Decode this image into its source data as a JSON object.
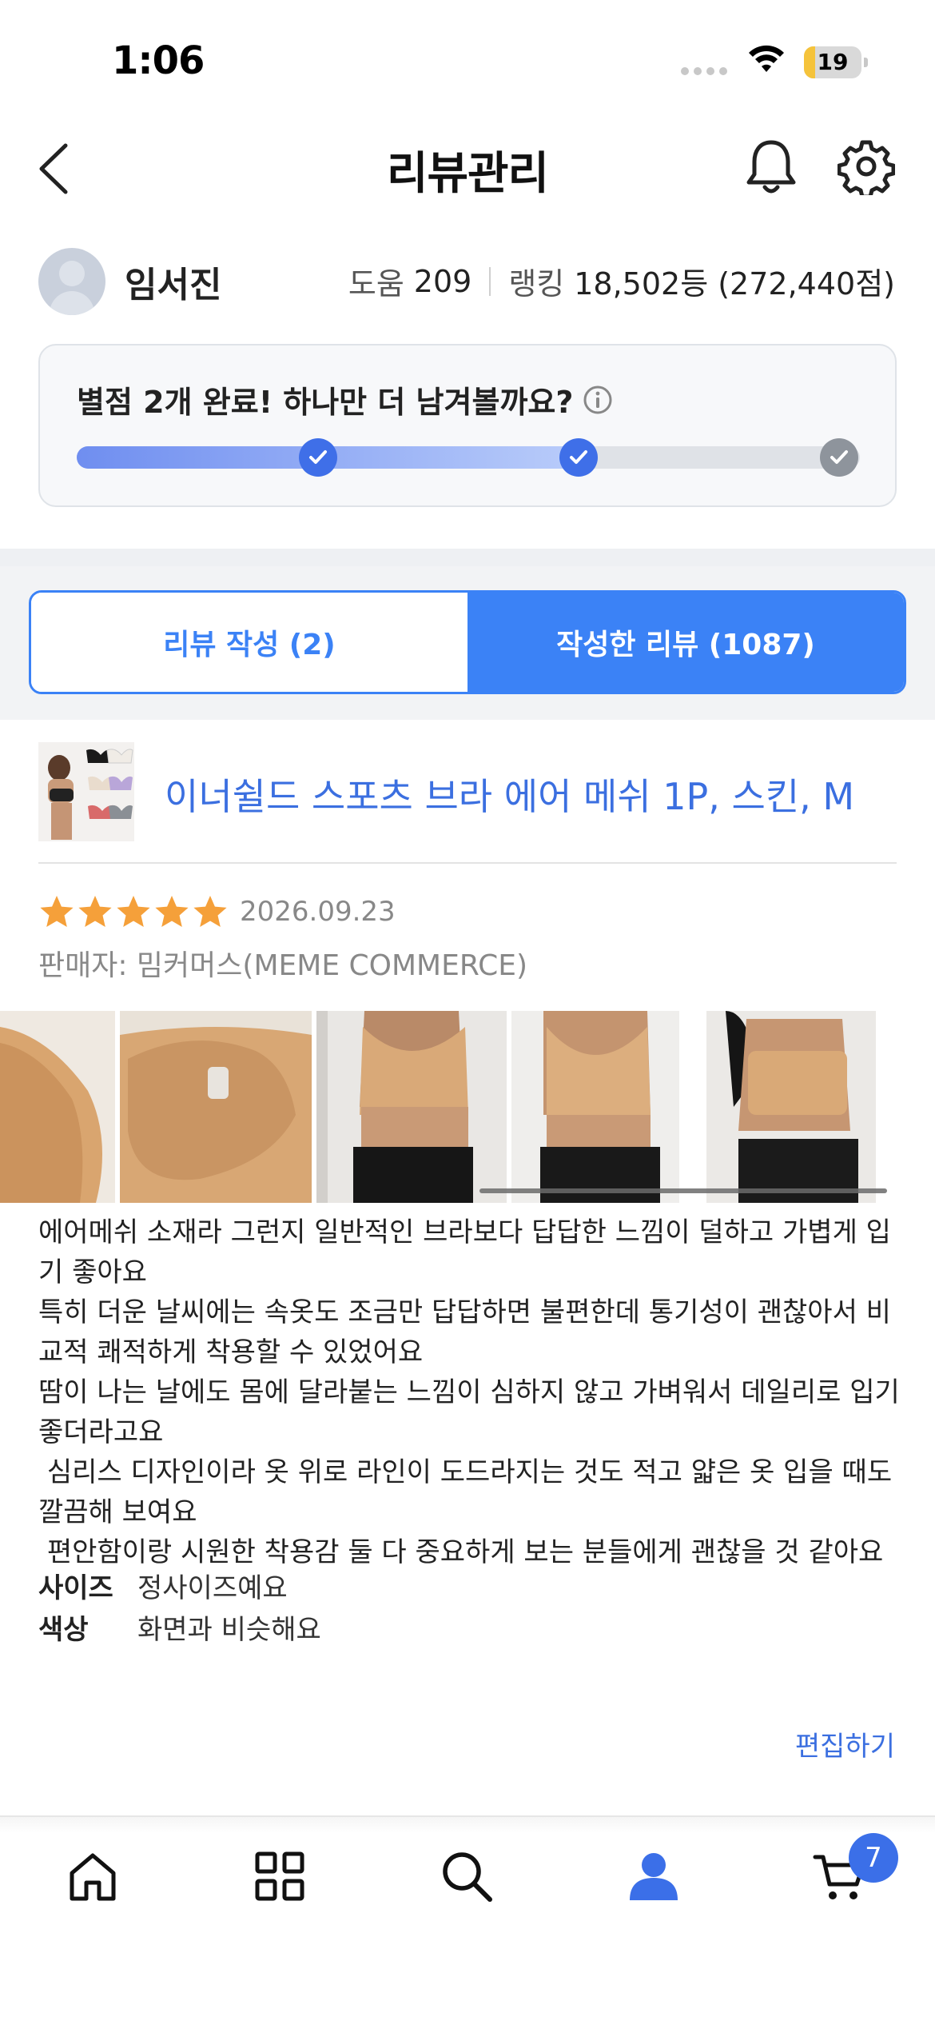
{
  "status_bar": {
    "time": "1:06",
    "battery": "19",
    "battery_level": 0.19
  },
  "header": {
    "title": "리뷰관리"
  },
  "profile": {
    "name": "임서진",
    "help_label": "도움",
    "help_value": "209",
    "ranking_label": "랭킹",
    "ranking_value": "18,502등 (272,440점)"
  },
  "progress": {
    "message": "별점 2개 완료! 하나만 더 남겨볼까요?",
    "completed": 2,
    "total": 3
  },
  "tabs": [
    {
      "label": "리뷰 작성 (2)",
      "active": false
    },
    {
      "label": "작성한 리뷰 (1087)",
      "active": true
    }
  ],
  "review": {
    "product_name": "이너쉴드 스포츠 브라 에어 메쉬 1P, 스킨, M",
    "rating": 5,
    "date": "2026.09.23",
    "seller": "판매자: 밈커머스(MEME COMMERCE)",
    "photo_count": 5,
    "body": "에어메쉬 소재라 그런지 일반적인 브라보다 답답한 느낌이 덜하고 가볍게 입기 좋아요\n특히 더운 날씨에는 속옷도 조금만 답답하면 불편한데 통기성이 괜찮아서 비교적 쾌적하게 착용할 수 있었어요\n땀이 나는 날에도 몸에 달라붙는 느낌이 심하지 않고 가벼워서 데일리로 입기 좋더라고요\n 심리스 디자인이라 옷 위로 라인이 도드라지는 것도 적고 얇은 옷 입을 때도 깔끔해 보여요\n 편안함이랑 시원한 착용감 둘 다 중요하게 보는 분들에게 괜찮을 것 같아요",
    "attributes": [
      {
        "key": "사이즈",
        "value": "정사이즈예요"
      },
      {
        "key": "색상",
        "value": "화면과 비슷해요"
      }
    ],
    "edit_label": "편집하기"
  },
  "tabbar": {
    "items": [
      "home-icon",
      "categories-icon",
      "search-icon",
      "my-page-icon",
      "cart-icon"
    ],
    "active": "my-page-icon",
    "cart_count": "7",
    "accent": "#3b6fe8"
  },
  "colors": {
    "accent": "#3b82f6",
    "star": "#f5a03a",
    "link": "#3b6fe0"
  }
}
